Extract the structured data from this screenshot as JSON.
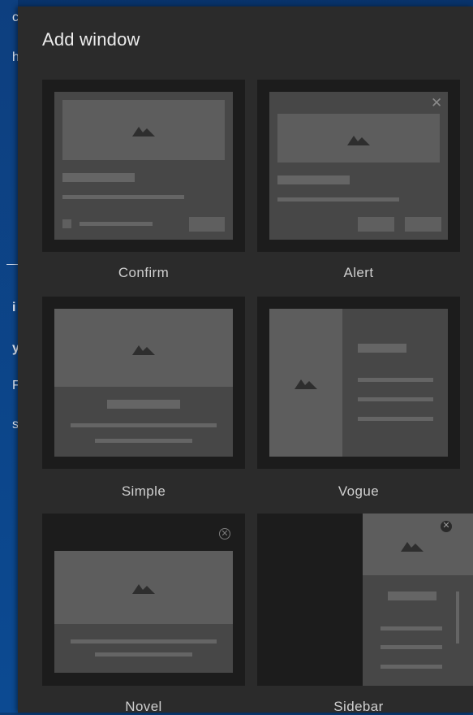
{
  "panel": {
    "title": "Add window"
  },
  "templates": [
    {
      "label": "Confirm"
    },
    {
      "label": "Alert"
    },
    {
      "label": "Simple"
    },
    {
      "label": "Vogue"
    },
    {
      "label": "Novel"
    },
    {
      "label": "Sidebar"
    }
  ],
  "background_text": [
    "c",
    "h",
    "i",
    "y",
    "F",
    "s"
  ],
  "colors": {
    "panel": "#2b2b2b",
    "tile": "#1c1c1c",
    "frame": "#474747",
    "placeholder": "#5d5d5d",
    "background": "#0a4288"
  }
}
